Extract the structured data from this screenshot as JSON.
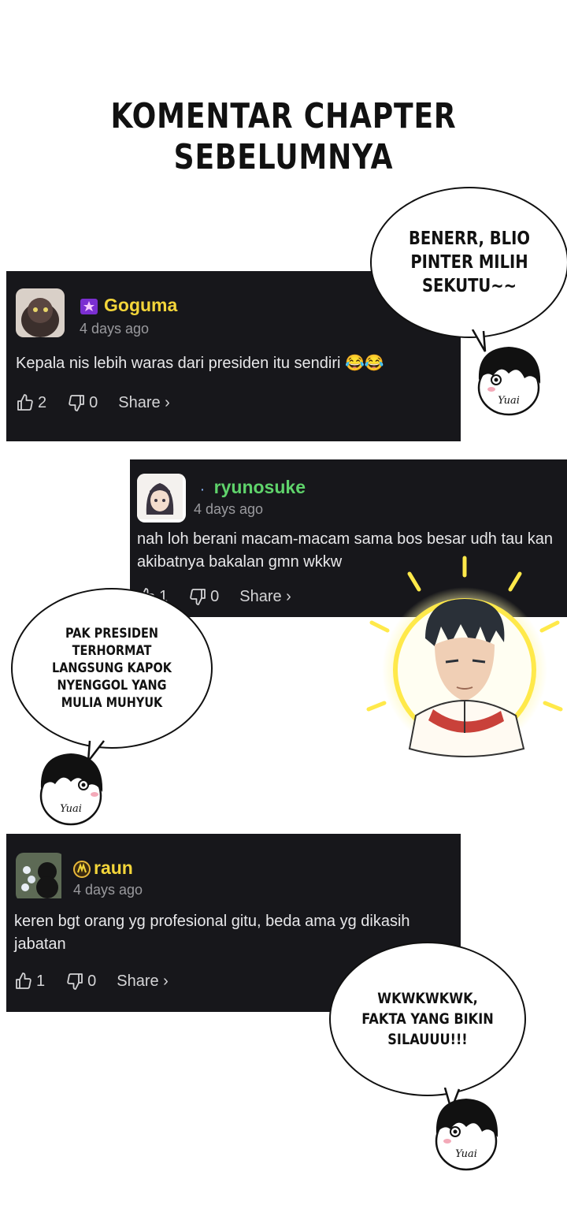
{
  "title_line1": "KOMENTAR CHAPTER",
  "title_line2": "SEBELUMNYA",
  "comments": [
    {
      "username": "Goguma",
      "time": "4 days ago",
      "text": "Kepala nis lebih waras dari presiden itu sendiri 😂😂",
      "likes": "2",
      "dislikes": "0",
      "share": "Share ›",
      "name_color": "#f3d53a"
    },
    {
      "username": "ryunosuke",
      "time": "4 days ago",
      "text": "nah loh berani macam-macam sama bos besar udh tau kan akibatnya bakalan gmn wkkw",
      "likes": "1",
      "dislikes": "0",
      "share": "Share ›",
      "name_color": "#5fd36b"
    },
    {
      "username": "raun",
      "time": "4 days ago",
      "text": "keren bgt orang yg profesional gitu, beda ama yg dikasih jabatan",
      "likes": "1",
      "dislikes": "0",
      "share": "Share ›",
      "name_color": "#f3d53a"
    }
  ],
  "bubbles": [
    {
      "text": "BENERR, BLIO PINTER MILIH SEKUTU~~"
    },
    {
      "text": "PAK PRESIDEN TERHORMAT LANGSUNG KAPOK NYENGGOL YANG MULIA MUHYUK"
    },
    {
      "text": "WKWKWKWK, FAKTA YANG BIKIN SILAUUU!!!"
    }
  ],
  "mascot_label": "Yuai"
}
